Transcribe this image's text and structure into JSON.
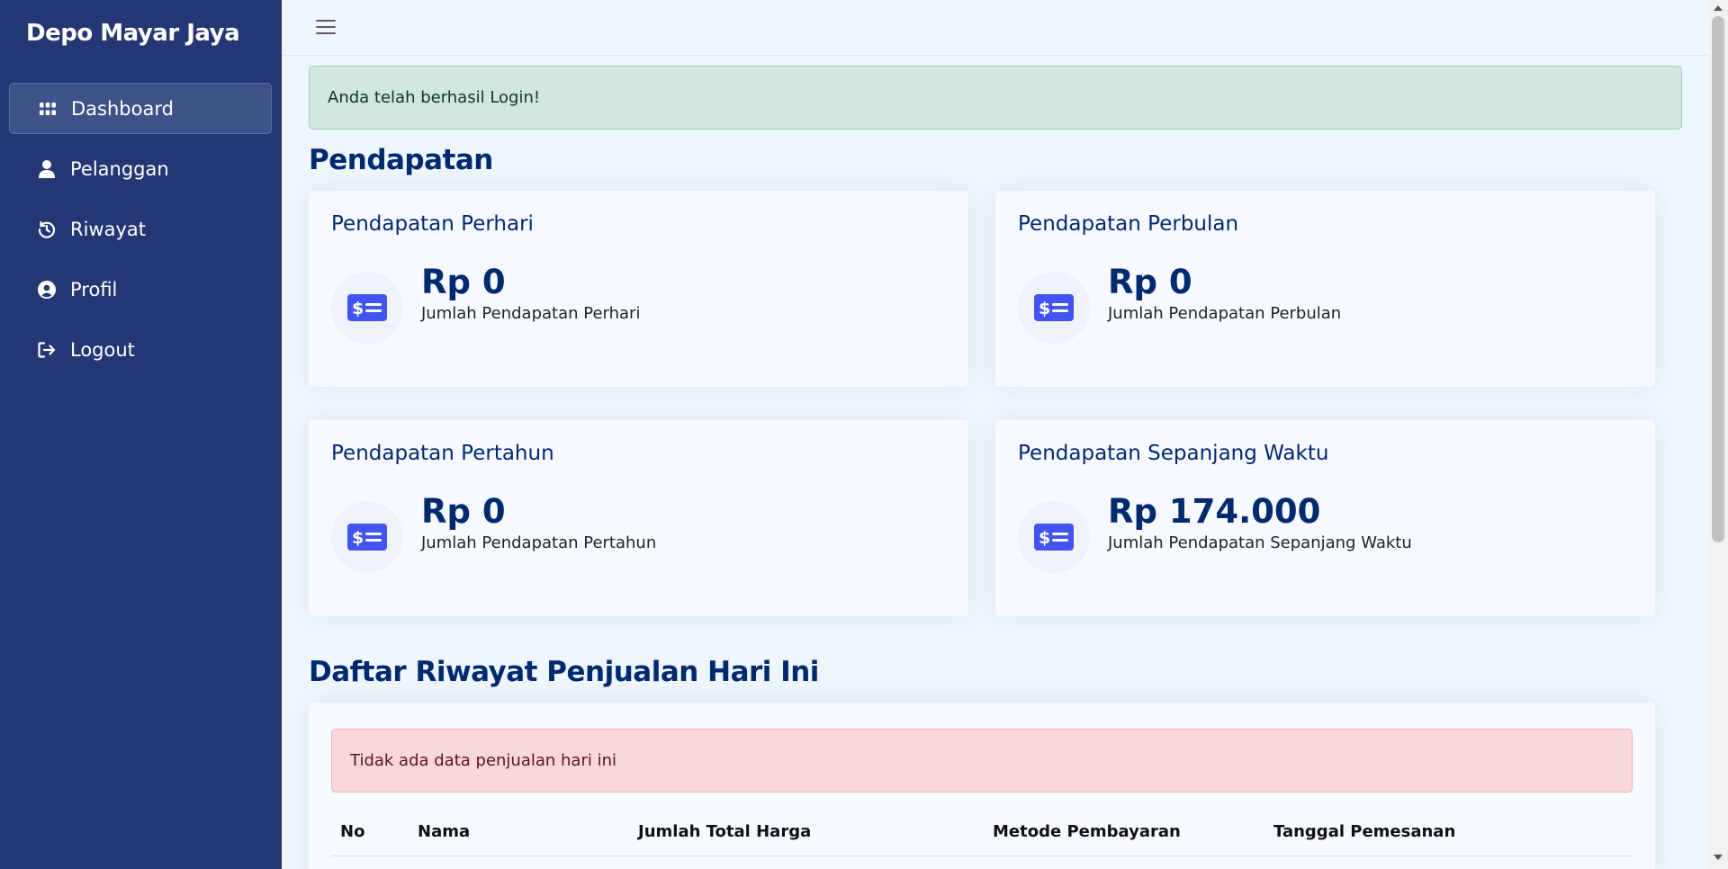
{
  "sidebar": {
    "brand": "Depo Mayar Jaya",
    "items": [
      {
        "label": "Dashboard",
        "icon": "grid-icon",
        "active": true
      },
      {
        "label": "Pelanggan",
        "icon": "person-icon",
        "active": false
      },
      {
        "label": "Riwayat",
        "icon": "history-icon",
        "active": false
      },
      {
        "label": "Profil",
        "icon": "user-circle-icon",
        "active": false
      },
      {
        "label": "Logout",
        "icon": "logout-icon",
        "active": false
      }
    ]
  },
  "topbar": {
    "menu_icon": "hamburger-icon"
  },
  "alerts": {
    "login_success": "Anda telah berhasil Login!",
    "no_sales": "Tidak ada data penjualan hari ini"
  },
  "revenue": {
    "section_title": "Pendapatan",
    "cards": [
      {
        "title": "Pendapatan Perhari",
        "value": "Rp 0",
        "subtitle": "Jumlah Pendapatan Perhari",
        "icon": "cash-icon"
      },
      {
        "title": "Pendapatan Perbulan",
        "value": "Rp 0",
        "subtitle": "Jumlah Pendapatan Perbulan",
        "icon": "cash-icon"
      },
      {
        "title": "Pendapatan Pertahun",
        "value": "Rp 0",
        "subtitle": "Jumlah Pendapatan Pertahun",
        "icon": "cash-icon"
      },
      {
        "title": "Pendapatan Sepanjang Waktu",
        "value": "Rp 174.000",
        "subtitle": "Jumlah Pendapatan Sepanjang Waktu",
        "icon": "cash-icon"
      }
    ]
  },
  "sales_history": {
    "section_title": "Daftar Riwayat Penjualan Hari Ini",
    "columns": [
      "No",
      "Nama",
      "Jumlah Total Harga",
      "Metode Pembayaran",
      "Tanggal Pemesanan"
    ]
  },
  "colors": {
    "sidebar_bg": "#243673",
    "accent": "#4154f1",
    "heading": "#012970",
    "page_bg": "#eef5fd"
  }
}
